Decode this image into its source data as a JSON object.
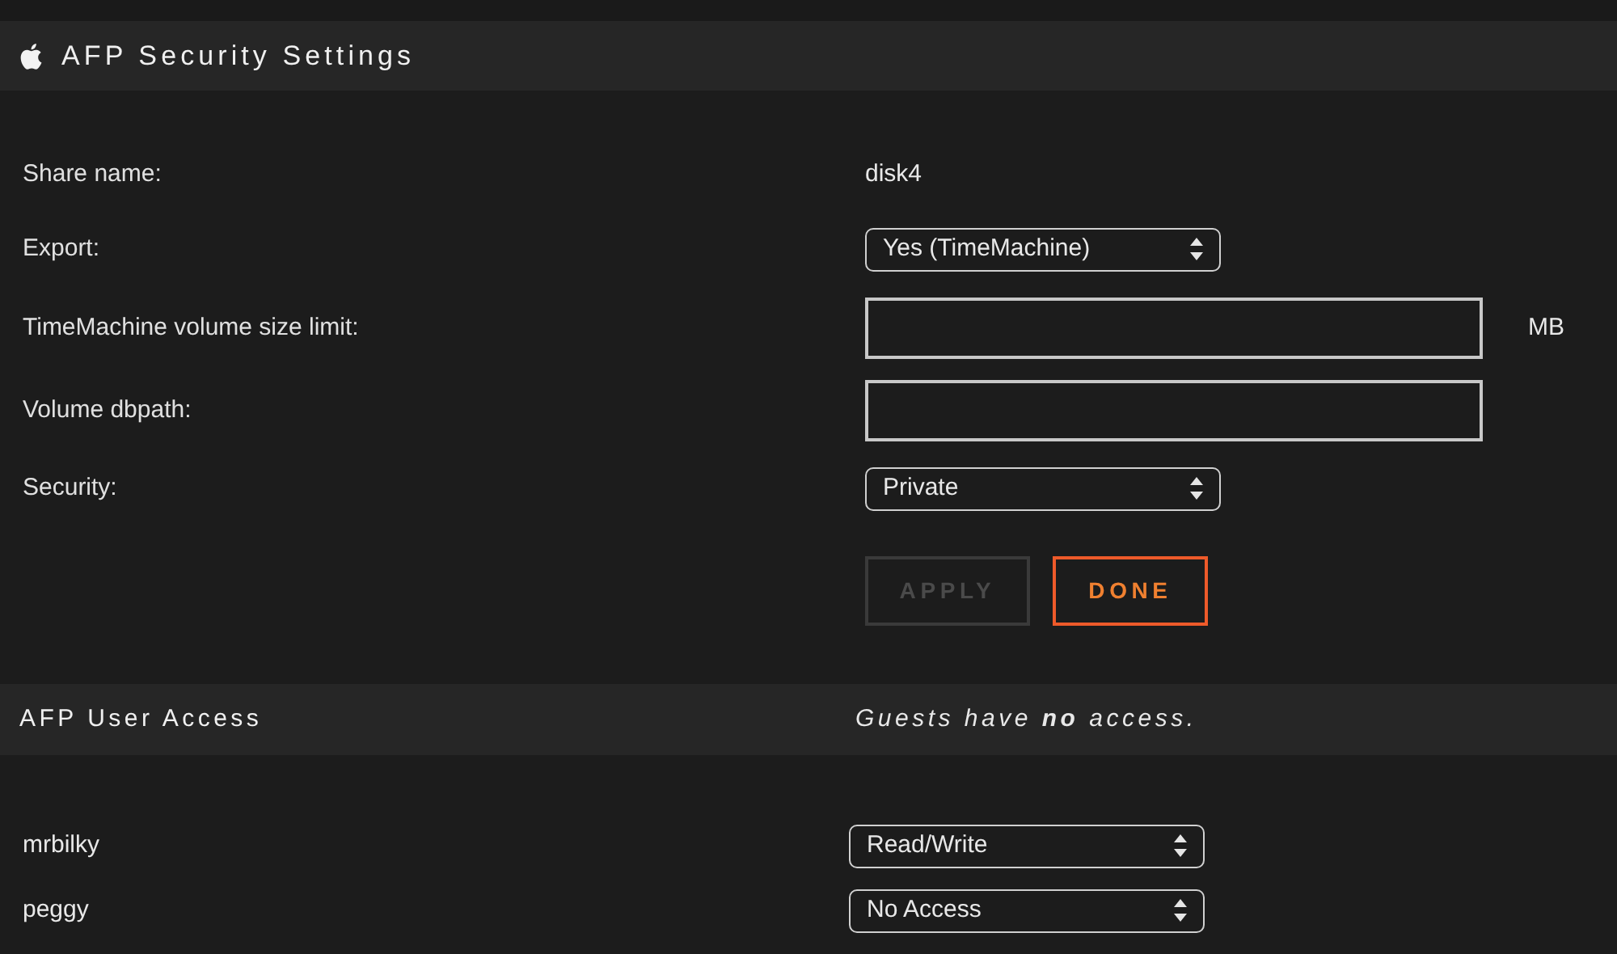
{
  "header": {
    "title": "AFP Security Settings"
  },
  "settings": [
    {
      "label": "Share name:",
      "kind": "text",
      "value": "disk4"
    },
    {
      "label": "Export:",
      "kind": "select",
      "value": "Yes (TimeMachine)"
    },
    {
      "label": "TimeMachine volume size limit:",
      "kind": "input",
      "unit": "MB"
    },
    {
      "label": "Volume dbpath:",
      "kind": "input"
    },
    {
      "label": "Security:",
      "kind": "select",
      "value": "Private"
    }
  ],
  "buttons": [
    {
      "label": "APPLY",
      "disabled": true
    },
    {
      "label": "DONE",
      "disabled": false
    }
  ],
  "user_access": {
    "title": "AFP User Access",
    "note": "Guests have **no** access.",
    "users": [
      {
        "name": "mrbilky",
        "access": "Read/Write"
      },
      {
        "name": "peggy",
        "access": "No Access"
      }
    ]
  }
}
